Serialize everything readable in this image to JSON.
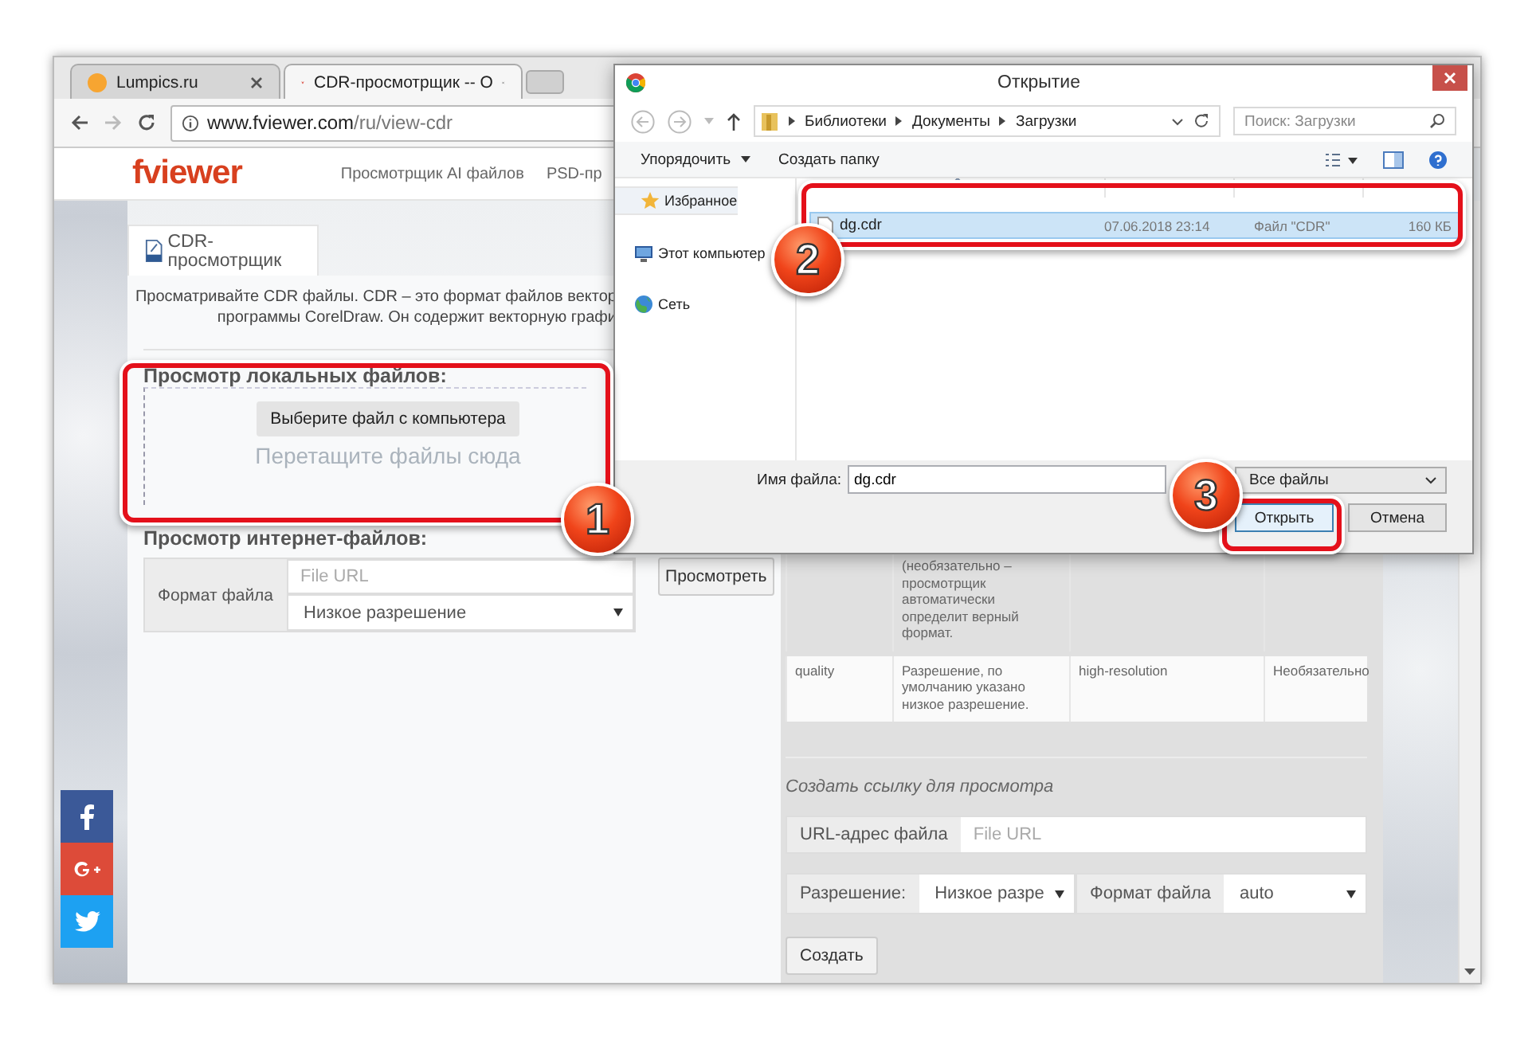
{
  "browser": {
    "tabs": [
      {
        "title": "Lumpics.ru",
        "kind": "lumpics",
        "selected": false
      },
      {
        "title": "CDR-просмотрщик -- О",
        "kind": "fviewer",
        "selected": true
      }
    ],
    "url": {
      "host": "www.fviewer.com",
      "path": "/ru/view-cdr"
    }
  },
  "site": {
    "logo": "fviewer",
    "nav": [
      "Просмотрщик AI файлов",
      "PSD-пр"
    ]
  },
  "viewer_tab": "CDR-просмотрщик",
  "intro": [
    "Просматривайте CDR файлы. CDR – это формат файлов вектор",
    "программы CorelDraw. Он содержит векторную графи"
  ],
  "local": {
    "title": "Просмотр локальных файлов:",
    "button": "Выберите файл с компьютера",
    "drop_hint": "Перетащите файлы сюда"
  },
  "internet": {
    "title": "Просмотр интернет-файлов:",
    "label": "Формат файла",
    "url_placeholder": "File URL",
    "quality": "Низкое разрешение",
    "view_button": "Просмотреть"
  },
  "params_table": {
    "rows": [
      {
        "column_2": "(необязательно – просмотрщик автоматически определит верный формат."
      },
      {
        "column_1": "quality",
        "column_2": "Разрешение, по умолчанию указано низкое разрешение.",
        "column_3": "high-resolution",
        "column_4": "Необязательно"
      }
    ]
  },
  "link_form": {
    "title": "Создать ссылку для просмотра",
    "url_label": "URL-адрес файла",
    "url_placeholder": "File URL",
    "resolution_label": "Разрешение:",
    "resolution": "Низкое разре",
    "format_label": "Формат файла",
    "format": "auto",
    "create_button": "Создать"
  },
  "social": [
    {
      "kind": "facebook"
    },
    {
      "kind": "googleplus"
    },
    {
      "kind": "twitter"
    }
  ],
  "dialog": {
    "title": "Открытие",
    "path": [
      "Библиотеки",
      "Документы",
      "Загрузки"
    ],
    "search_placeholder": "Поиск: Загрузки",
    "organize": "Упорядочить",
    "new_folder": "Создать папку",
    "nav": [
      {
        "label": "Избранное",
        "kind": "favorites"
      },
      {
        "label": "Этот компьютер",
        "kind": "computer"
      },
      {
        "label": "Сеть",
        "kind": "network"
      }
    ],
    "files": [
      {
        "name": "dg.cdr",
        "date": "07.06.2018 23:14",
        "type": "Файл \"CDR\"",
        "size": "160 КБ",
        "selected": true
      }
    ],
    "filename_label": "Имя файла:",
    "filename": "dg.cdr",
    "filter": "Все файлы",
    "open_button": "Открыть",
    "cancel_button": "Отмена"
  },
  "annotations": [
    {
      "number": "1"
    },
    {
      "number": "2"
    },
    {
      "number": "3"
    }
  ]
}
